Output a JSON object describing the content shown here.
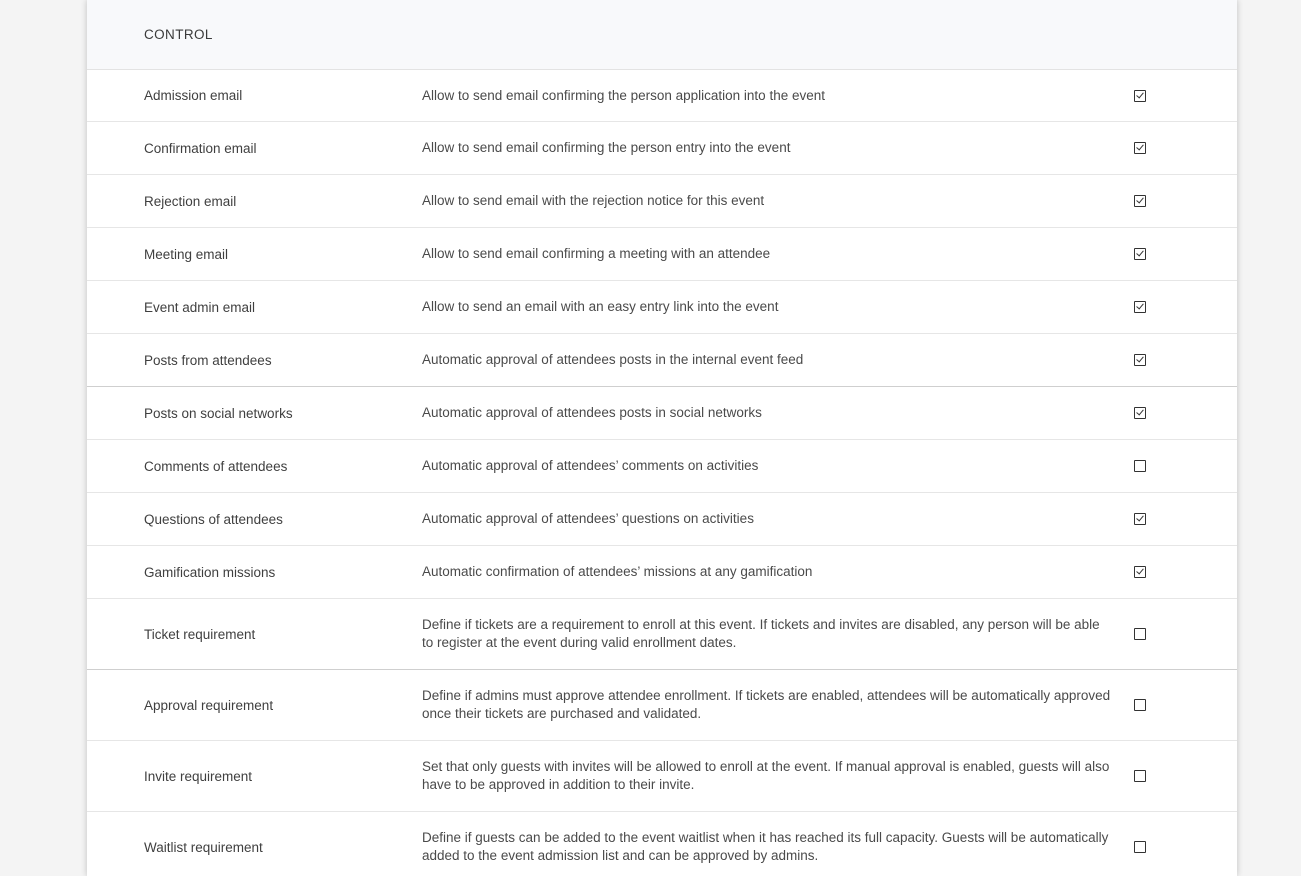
{
  "section": {
    "title": "CONTROL"
  },
  "rows": [
    {
      "name": "Admission email",
      "description": "Allow to send email confirming the person application into the event",
      "checked": true
    },
    {
      "name": "Confirmation email",
      "description": "Allow to send email confirming the person entry into the event",
      "checked": true
    },
    {
      "name": "Rejection email",
      "description": "Allow to send email with the rejection notice for this event",
      "checked": true
    },
    {
      "name": "Meeting email",
      "description": "Allow to send email confirming a meeting with an attendee",
      "checked": true
    },
    {
      "name": "Event admin email",
      "description": "Allow to send an email with an easy entry link into the event",
      "checked": true
    },
    {
      "name": "Posts from attendees",
      "description": "Automatic approval of attendees posts in the internal event feed",
      "checked": true
    },
    {
      "name": "Posts on social networks",
      "description": "Automatic approval of attendees posts in social networks",
      "checked": true
    },
    {
      "name": "Comments of attendees",
      "description": "Automatic approval of attendees’ comments on activities",
      "checked": false
    },
    {
      "name": "Questions of attendees",
      "description": "Automatic approval of attendees’ questions on activities",
      "checked": true
    },
    {
      "name": "Gamification missions",
      "description": "Automatic confirmation of attendees’ missions at any gamification",
      "checked": true
    },
    {
      "name": "Ticket requirement",
      "description": "Define if tickets are a requirement to enroll at this event. If tickets and invites are disabled, any person will be able to register at the event during valid enrollment dates.",
      "checked": false
    },
    {
      "name": "Approval requirement",
      "description": "Define if admins must approve attendee enrollment. If tickets are enabled, attendees will be automatically approved once their tickets are purchased and validated.",
      "checked": false
    },
    {
      "name": "Invite requirement",
      "description": "Set that only guests with invites will be allowed to enroll at the event. If manual approval is enabled, guests will also have to be approved in addition to their invite.",
      "checked": false
    },
    {
      "name": "Waitlist requirement",
      "description": "Define if guests can be added to the event waitlist when it has reached its full capacity. Guests will be automatically added to the event admission list and can be approved by admins.",
      "checked": false
    }
  ]
}
